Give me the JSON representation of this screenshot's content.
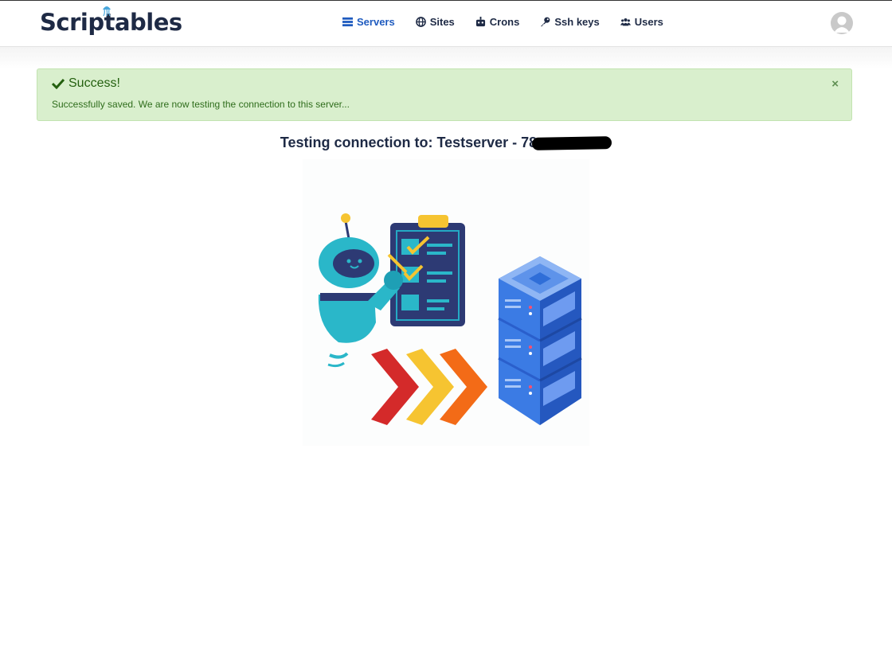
{
  "brand": {
    "name": "Scriptables"
  },
  "nav": {
    "items": [
      {
        "label": "Servers",
        "icon": "server-icon",
        "active": true
      },
      {
        "label": "Sites",
        "icon": "globe-icon",
        "active": false
      },
      {
        "label": "Crons",
        "icon": "robot-icon",
        "active": false
      },
      {
        "label": "Ssh keys",
        "icon": "key-icon",
        "active": false
      },
      {
        "label": "Users",
        "icon": "users-icon",
        "active": false
      }
    ]
  },
  "alert": {
    "title": "Success!",
    "message": "Successfully saved. We are now testing the connection to this server...",
    "close": "×"
  },
  "main": {
    "heading_prefix": "Testing connection to: Testserver - 78"
  },
  "colors": {
    "accent": "#1f5bbf",
    "success_bg": "#d9efcd",
    "success_text": "#2b6a1a",
    "text": "#1e2a45"
  }
}
